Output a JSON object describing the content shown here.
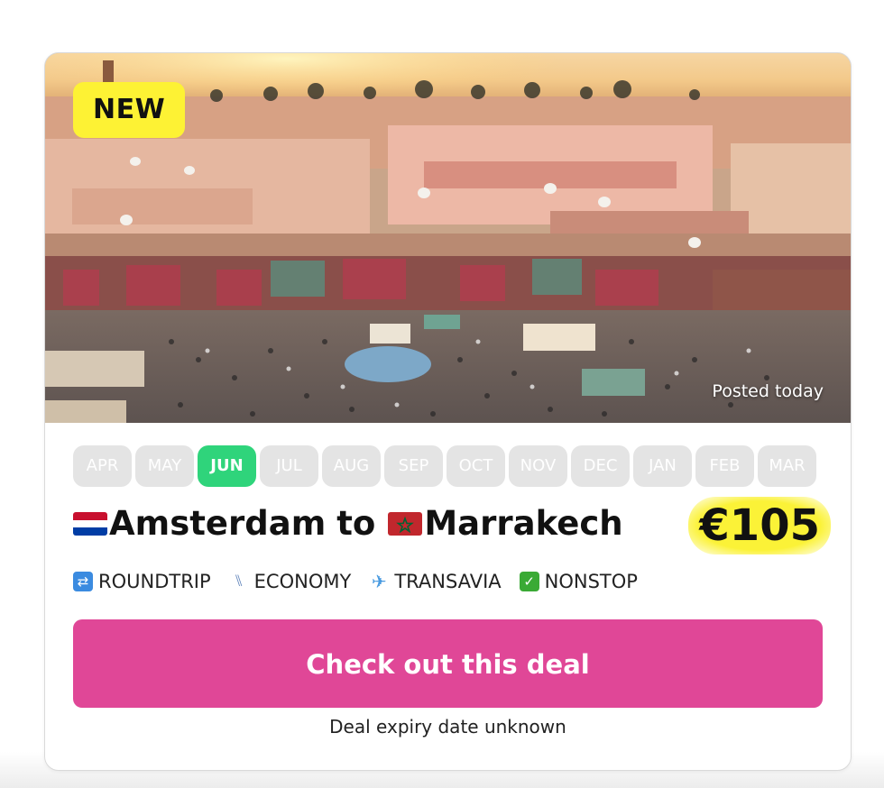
{
  "card": {
    "badge": "NEW",
    "posted": "Posted today",
    "months": [
      {
        "label": "APR",
        "active": false
      },
      {
        "label": "MAY",
        "active": false
      },
      {
        "label": "JUN",
        "active": true
      },
      {
        "label": "JUL",
        "active": false
      },
      {
        "label": "AUG",
        "active": false
      },
      {
        "label": "SEP",
        "active": false
      },
      {
        "label": "OCT",
        "active": false
      },
      {
        "label": "NOV",
        "active": false
      },
      {
        "label": "DEC",
        "active": false
      },
      {
        "label": "JAN",
        "active": false
      },
      {
        "label": "FEB",
        "active": false
      },
      {
        "label": "MAR",
        "active": false
      }
    ],
    "origin": "Amsterdam",
    "connector": "to",
    "destination": "Marrakech",
    "price": "€105",
    "features": [
      {
        "icon": "roundtrip-icon",
        "label": "ROUNDTRIP"
      },
      {
        "icon": "seat-icon",
        "label": "ECONOMY"
      },
      {
        "icon": "airplane-icon",
        "label": "TRANSAVIA"
      },
      {
        "icon": "checkmark-icon",
        "label": "NONSTOP"
      }
    ],
    "cta_label": "Check out this deal",
    "expiry": "Deal expiry date unknown"
  },
  "colors": {
    "badge_yellow": "#fdf234",
    "active_month": "#2fd47b",
    "inactive_month": "#e4e4e4",
    "cta_pink": "#e04797",
    "price_highlight": "#fbf237"
  }
}
